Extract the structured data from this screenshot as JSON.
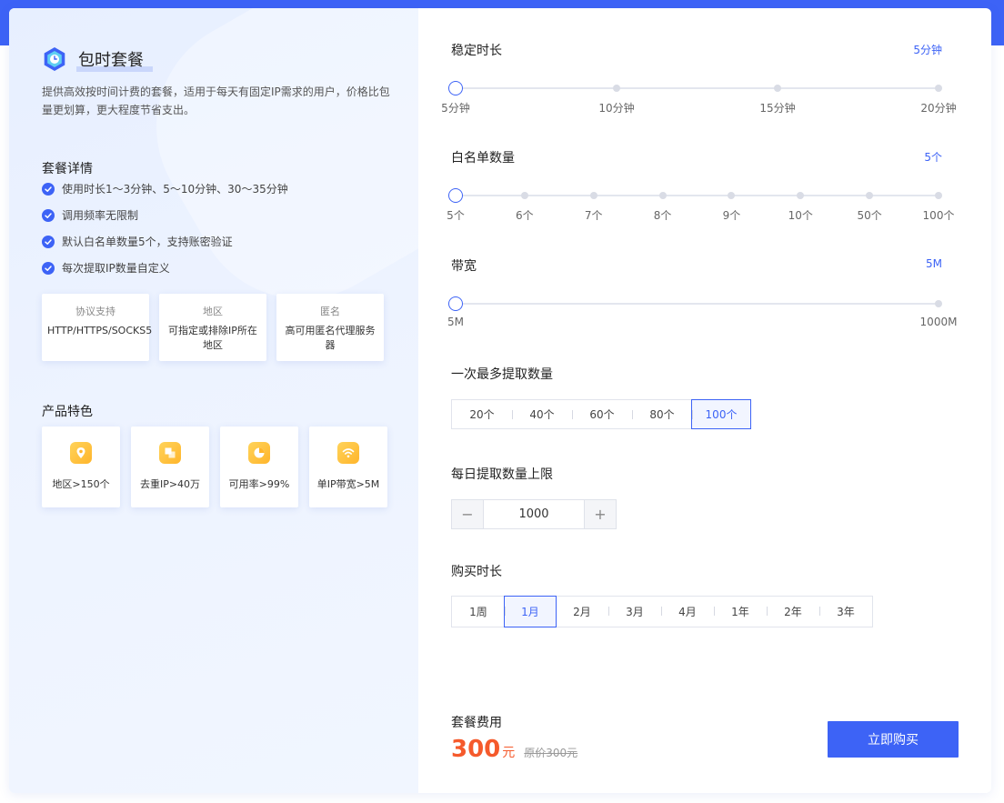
{
  "colors": {
    "primary": "#3d63f6",
    "price": "#f55a2c"
  },
  "plan": {
    "title": "包时套餐",
    "icon": "clock-hex-icon",
    "description": "提供高效按时间计费的套餐，适用于每天有固定IP需求的用户，价格比包量更划算，更大程度节省支出。"
  },
  "details": {
    "heading": "套餐详情",
    "items": [
      "使用时长1～3分钟、5～10分钟、30～35分钟",
      "调用频率无限制",
      "默认白名单数量5个，支持账密验证",
      "每次提取IP数量自定义"
    ]
  },
  "info_boxes": [
    {
      "heading": "协议支持",
      "value": "HTTP/HTTPS/SOCKS5"
    },
    {
      "heading": "地区",
      "value": "可指定或排除IP所在地区"
    },
    {
      "heading": "匿名",
      "value": "高可用匿名代理服务器"
    }
  ],
  "features": {
    "heading": "产品特色",
    "items": [
      {
        "label": "地区>150个",
        "icon": "location-pin-icon"
      },
      {
        "label": "去重IP>40万",
        "icon": "dedupe-icon"
      },
      {
        "label": "可用率>99%",
        "icon": "pie-chart-icon"
      },
      {
        "label": "单IP带宽>5M",
        "icon": "wifi-icon"
      }
    ]
  },
  "duration": {
    "label": "稳定时长",
    "value": "5分钟",
    "ticks": [
      "5分钟",
      "10分钟",
      "15分钟",
      "20分钟"
    ],
    "selected_index": 0
  },
  "whitelist": {
    "label": "白名单数量",
    "value": "5个",
    "ticks": [
      "5个",
      "6个",
      "7个",
      "8个",
      "9个",
      "10个",
      "50个",
      "100个"
    ],
    "selected_index": 0
  },
  "bandwidth": {
    "label": "带宽",
    "value": "5M",
    "ticks": [
      "5M",
      "1000M"
    ],
    "selected_index": 0
  },
  "max_extract": {
    "label": "一次最多提取数量",
    "options": [
      "20个",
      "40个",
      "60个",
      "80个",
      "100个"
    ],
    "selected_index": 4
  },
  "daily_limit": {
    "label": "每日提取数量上限",
    "value": "1000",
    "minus": "−",
    "plus": "+"
  },
  "purchase_duration": {
    "label": "购买时长",
    "options": [
      "1周",
      "1月",
      "2月",
      "3月",
      "4月",
      "1年",
      "2年",
      "3年"
    ],
    "selected_index": 1
  },
  "price": {
    "label": "套餐费用",
    "amount": "300",
    "unit": "元",
    "original": "原价300元"
  },
  "buy_button": "立即购买"
}
